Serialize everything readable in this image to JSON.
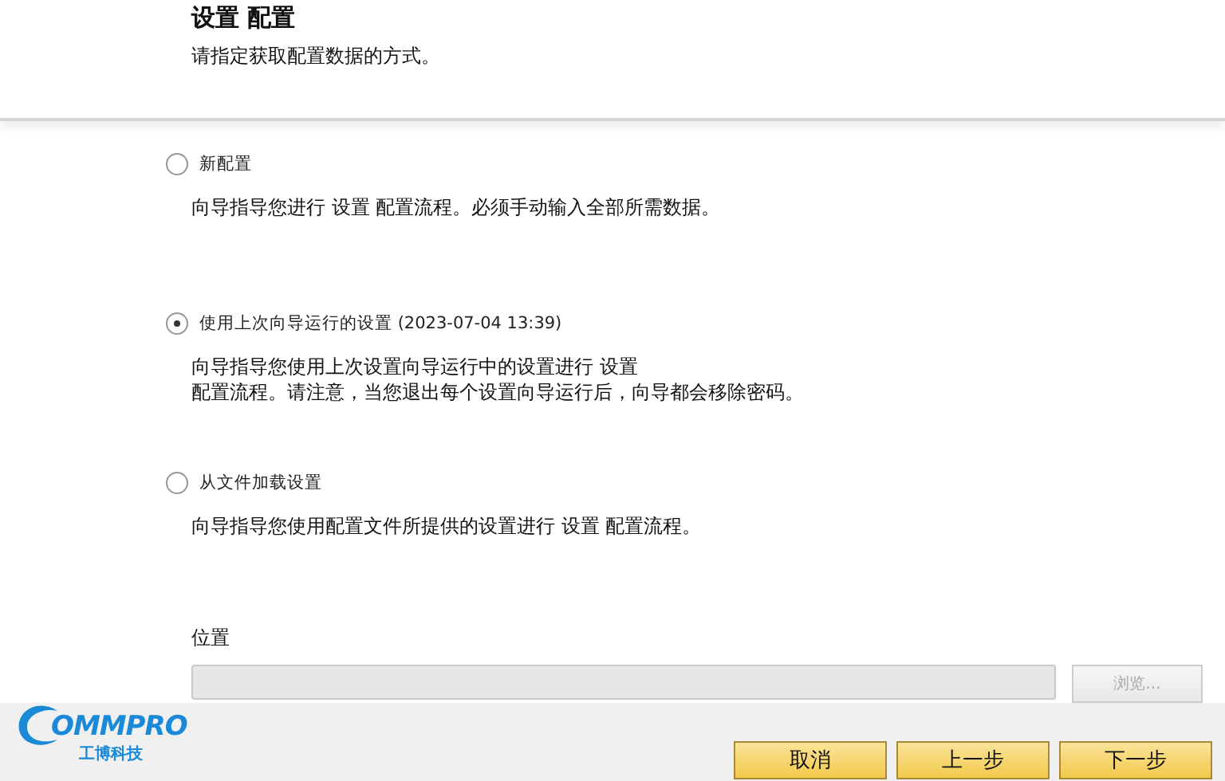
{
  "header": {
    "title": "设置 配置",
    "subtitle": "请指定获取配置数据的方式。"
  },
  "options": [
    {
      "label": "新配置",
      "selected": false,
      "description": "向导指导您进行 设置 配置流程。必须手动输入全部所需数据。"
    },
    {
      "label": "使用上次向导运行的设置 (2023-07-04 13:39)",
      "selected": true,
      "description": "向导指导您使用上次设置向导运行中的设置进行 设置",
      "description_line_2": "配置流程。请注意，当您退出每个设置向导运行后，向导都会移除密码。"
    },
    {
      "label": "从文件加载设置",
      "selected": false,
      "description": "向导指导您使用配置文件所提供的设置进行 设置 配置流程。"
    }
  ],
  "location": {
    "label": "位置",
    "disabled": true,
    "browse": {
      "label": "浏览...",
      "disabled": true
    }
  },
  "logo": {
    "wordmark": "OMMPRO",
    "subtitle": "工博科技"
  },
  "buttons": [
    {
      "label": "取消"
    },
    {
      "label": "上一步"
    },
    {
      "label": "下一步"
    }
  ]
}
